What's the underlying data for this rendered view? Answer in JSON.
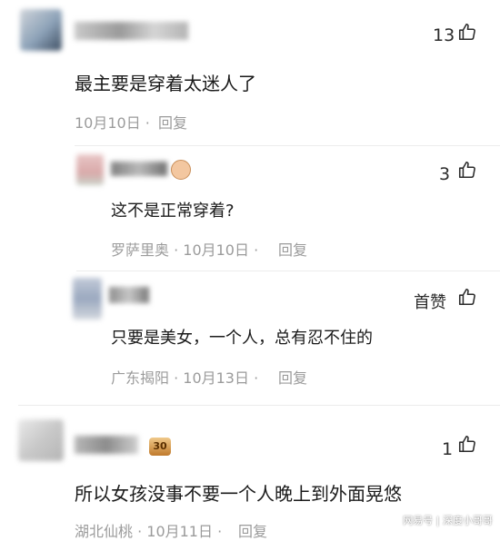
{
  "comments": [
    {
      "likes": "13",
      "text": "最主要是穿着太迷人了",
      "meta": "10月10日 ·",
      "reply": "回复"
    },
    {
      "likes": "3",
      "text": "这不是正常穿着?",
      "meta": "罗萨里奥 · 10月10日 ·",
      "reply": "回复"
    },
    {
      "likes": "首赞",
      "text": "只要是美女，一个人，总有忍不住的",
      "meta": "广东揭阳 · 10月13日 ·",
      "reply": "回复"
    },
    {
      "likes": "1",
      "badge": "30",
      "text": "所以女孩没事不要一个人晚上到外面晃悠",
      "meta": "湖北仙桃 · 10月11日 ·",
      "reply": "回复"
    }
  ],
  "watermark": "网易号 | 深度小哥哥",
  "icons": [
    "avatar-blurred",
    "thumb-up-icon",
    "level-badge-icon"
  ],
  "colors": {
    "text": "#1a1a1a",
    "meta": "#9b9b9b",
    "divider": "#ececec",
    "badge": "#c07a2c"
  }
}
